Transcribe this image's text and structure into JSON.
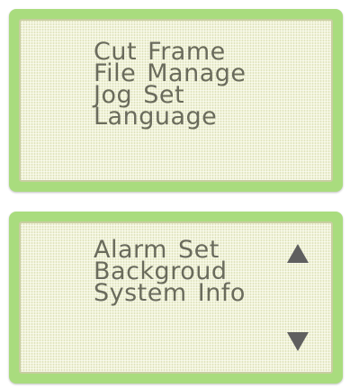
{
  "menu_page_1": {
    "items": [
      {
        "label": "Cut  Frame"
      },
      {
        "label": "File Manage"
      },
      {
        "label": "Jog Set"
      },
      {
        "label": "Language"
      }
    ]
  },
  "menu_page_2": {
    "items": [
      {
        "label": "Alarm Set"
      },
      {
        "label": "Backgroud"
      },
      {
        "label": "System Info"
      }
    ],
    "scroll_up_icon": "triangle-up-icon",
    "scroll_down_icon": "triangle-down-icon"
  },
  "colors": {
    "bezel": "#a9dc7e",
    "screen": "#f1f3d7",
    "text": "#6a6b5c",
    "arrow": "#5f5f5f"
  }
}
